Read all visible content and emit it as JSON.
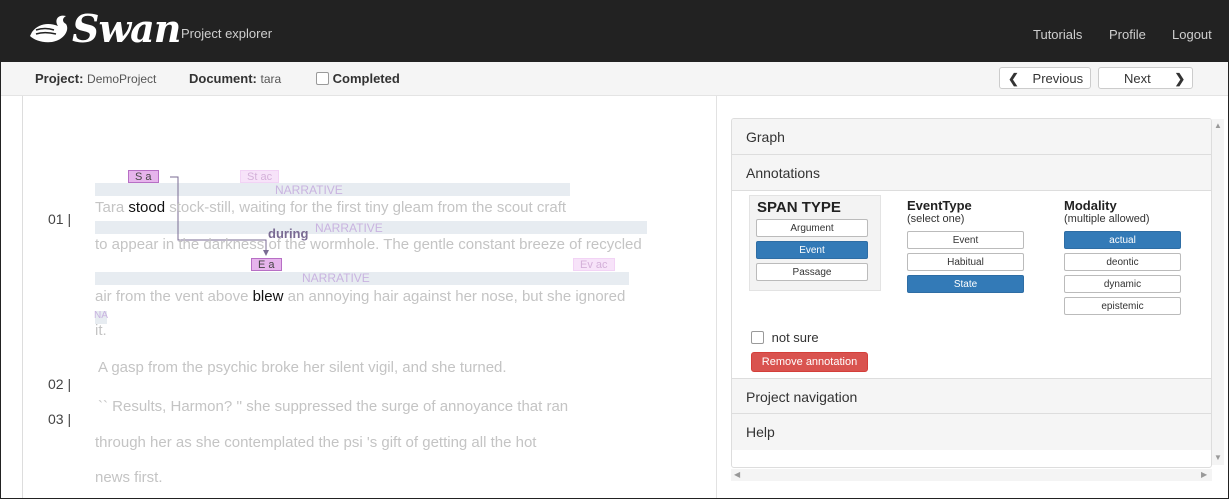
{
  "navbar": {
    "brand_text": "Swan",
    "brand_subtitle": "Project explorer",
    "links": [
      "Tutorials",
      "Profile",
      "Logout"
    ]
  },
  "subheader": {
    "project_label": "Project:",
    "project_value": "DemoProject",
    "document_label": "Document:",
    "document_value": "tara",
    "completed_label": "Completed",
    "previous_label": "Previous",
    "next_label": "Next"
  },
  "document": {
    "line_numbers": [
      "01 |",
      "02 |",
      "03 |"
    ],
    "lines": [
      {
        "before": "Tara ",
        "hl": "stood",
        "after": " stock-still, waiting for the first tiny gleam from the scout craft"
      },
      {
        "before": "to appear in the darkness of the wormhole. The gentle constant breeze of recycled",
        "hl": "",
        "after": ""
      },
      {
        "before": "air from the vent above ",
        "hl": "blew",
        "after": " an annoying hair against her nose, but she ignored"
      },
      {
        "before": "it.",
        "hl": "",
        "after": ""
      },
      {
        "before": "A gasp from the psychic broke her silent vigil, and she turned.",
        "hl": "",
        "after": ""
      },
      {
        "before": "`` Results, Harmon? '' she suppressed the surge of annoyance that ran",
        "hl": "",
        "after": ""
      },
      {
        "before": "through her as she contemplated the psi 's gift of getting all the hot",
        "hl": "",
        "after": ""
      },
      {
        "before": "news first.",
        "hl": "",
        "after": ""
      }
    ],
    "band_labels": [
      "NARRATIVE",
      "NARRATIVE",
      "NARRATIVE",
      "NA"
    ],
    "tags": {
      "tag1": "S a",
      "tag2": "St ac",
      "tag3": "E a",
      "tag4": "Ev ac"
    },
    "relation_label": "during"
  },
  "panel": {
    "headers": {
      "graph": "Graph",
      "annotations": "Annotations",
      "project_navigation": "Project navigation",
      "help": "Help"
    },
    "span_type": {
      "title": "SPAN TYPE",
      "options": [
        "Argument",
        "Event",
        "Passage"
      ],
      "selected": "Event"
    },
    "event_type": {
      "title": "EventType",
      "subtitle": "(select one)",
      "options": [
        "Event",
        "Habitual",
        "State"
      ],
      "selected": "State"
    },
    "modality": {
      "title": "Modality",
      "subtitle": "(multiple allowed)",
      "options": [
        "actual",
        "deontic",
        "dynamic",
        "epistemic"
      ],
      "selected": "actual"
    },
    "not_sure_label": "not sure",
    "remove_label": "Remove annotation"
  },
  "colors": {
    "navbar_bg": "#222222",
    "selected_blue": "#337ab7",
    "remove_red": "#d9534f",
    "tag_pink": "#e6b4ec"
  }
}
